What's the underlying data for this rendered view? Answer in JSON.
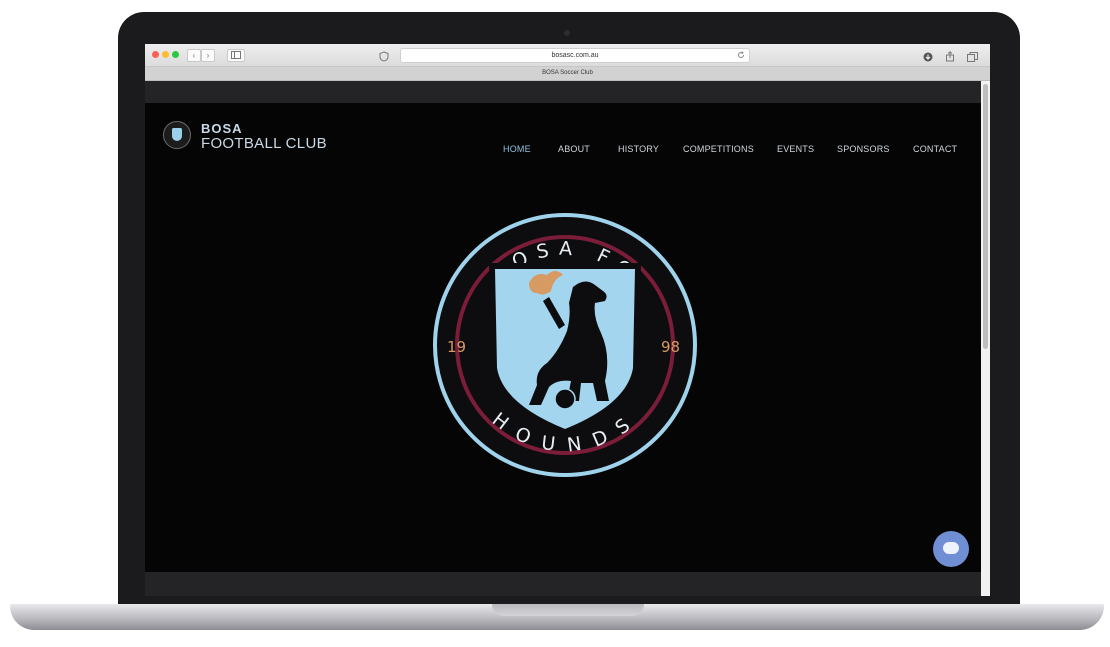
{
  "browser": {
    "url": "bosasc.com.au",
    "tab_title": "BOSA Soccer Club",
    "nav_back": "‹",
    "nav_forward": "›"
  },
  "site": {
    "brand_line1": "BOSA",
    "brand_line2": "FOOTBALL CLUB",
    "nav": {
      "home": "HOME",
      "about": "ABOUT",
      "history": "HISTORY",
      "competitions": "COMPETITIONS",
      "events": "EVENTS",
      "sponsors": "SPONSORS",
      "contact": "CONTACT"
    }
  },
  "crest": {
    "top_text": "BOSA FC",
    "bottom_text": "HOUNDS",
    "year_left": "19",
    "year_right": "98"
  },
  "colors": {
    "accent_blue": "#8ec3df",
    "crest_maroon": "#7b1d38",
    "crest_orange": "#d79a62",
    "page_bg": "#050505"
  },
  "icons": {
    "chat": "chat-bubble-icon",
    "reload": "reload-icon",
    "share": "share-icon",
    "sidebar": "sidebar-icon"
  }
}
